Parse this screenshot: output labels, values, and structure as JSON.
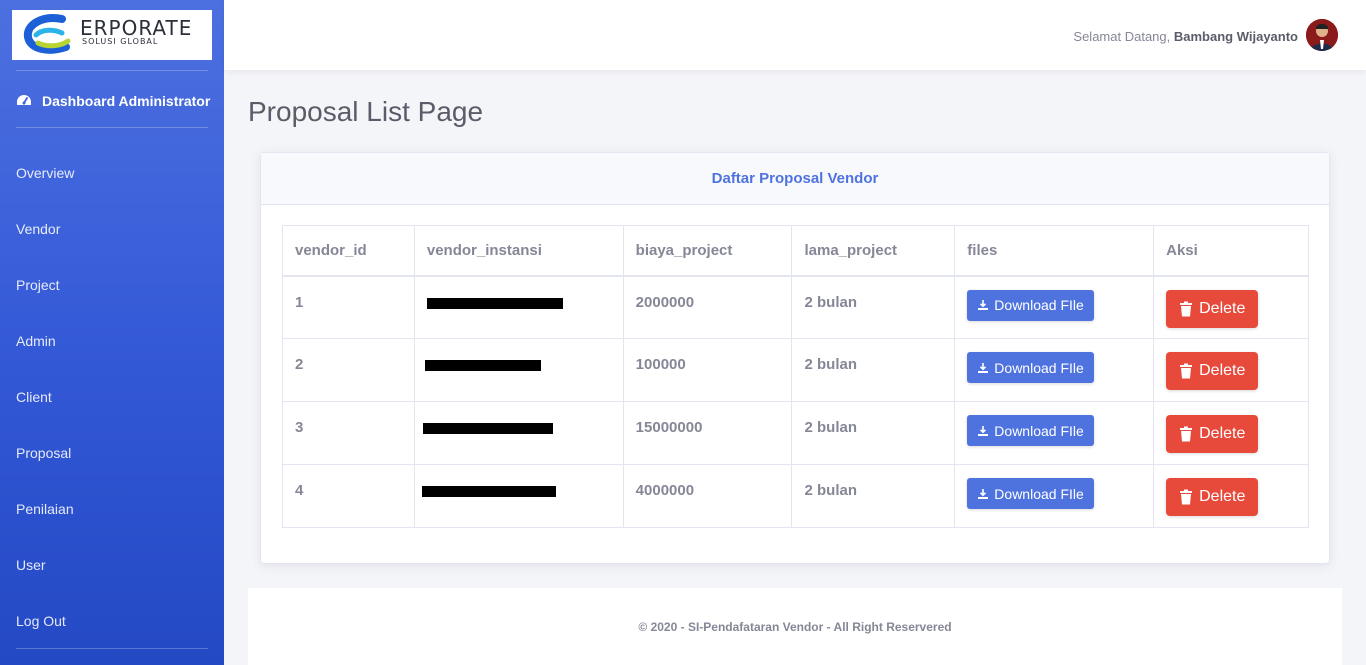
{
  "brand": {
    "name": "ERPORATE",
    "subtitle": "SOLUSI GLOBAL"
  },
  "sidebar": {
    "heading": "Dashboard Administrator",
    "heading_icon": "tachometer-icon",
    "items": [
      {
        "label": "Overview"
      },
      {
        "label": "Vendor"
      },
      {
        "label": "Project"
      },
      {
        "label": "Admin"
      },
      {
        "label": "Client"
      },
      {
        "label": "Proposal"
      },
      {
        "label": "Penilaian"
      },
      {
        "label": "User"
      },
      {
        "label": "Log Out"
      }
    ]
  },
  "topbar": {
    "greeting": "Selamat Datang,",
    "user_name": "Bambang Wijayanto"
  },
  "page": {
    "title": "Proposal List Page"
  },
  "card": {
    "title": "Daftar Proposal Vendor"
  },
  "table": {
    "headers": [
      "vendor_id",
      "vendor_instansi",
      "biaya_project",
      "lama_project",
      "files",
      "Aksi"
    ],
    "rows": [
      {
        "vendor_id": "1",
        "biaya_project": "2000000",
        "lama_project": "2 bulan",
        "download": "Download FIle",
        "delete": "Delete"
      },
      {
        "vendor_id": "2",
        "biaya_project": "100000",
        "lama_project": "2 bulan",
        "download": "Download FIle",
        "delete": "Delete"
      },
      {
        "vendor_id": "3",
        "biaya_project": "15000000",
        "lama_project": "2 bulan",
        "download": "Download FIle",
        "delete": "Delete"
      },
      {
        "vendor_id": "4",
        "biaya_project": "4000000",
        "lama_project": "2 bulan",
        "download": "Download FIle",
        "delete": "Delete"
      }
    ]
  },
  "footer": {
    "text": "© 2020 - SI-Pendafataran Vendor - All Right Reservered"
  },
  "colors": {
    "primary": "#4e73df",
    "danger": "#e74a3b",
    "sidebar_top": "#4d70e0",
    "sidebar_bottom": "#2449c4"
  }
}
